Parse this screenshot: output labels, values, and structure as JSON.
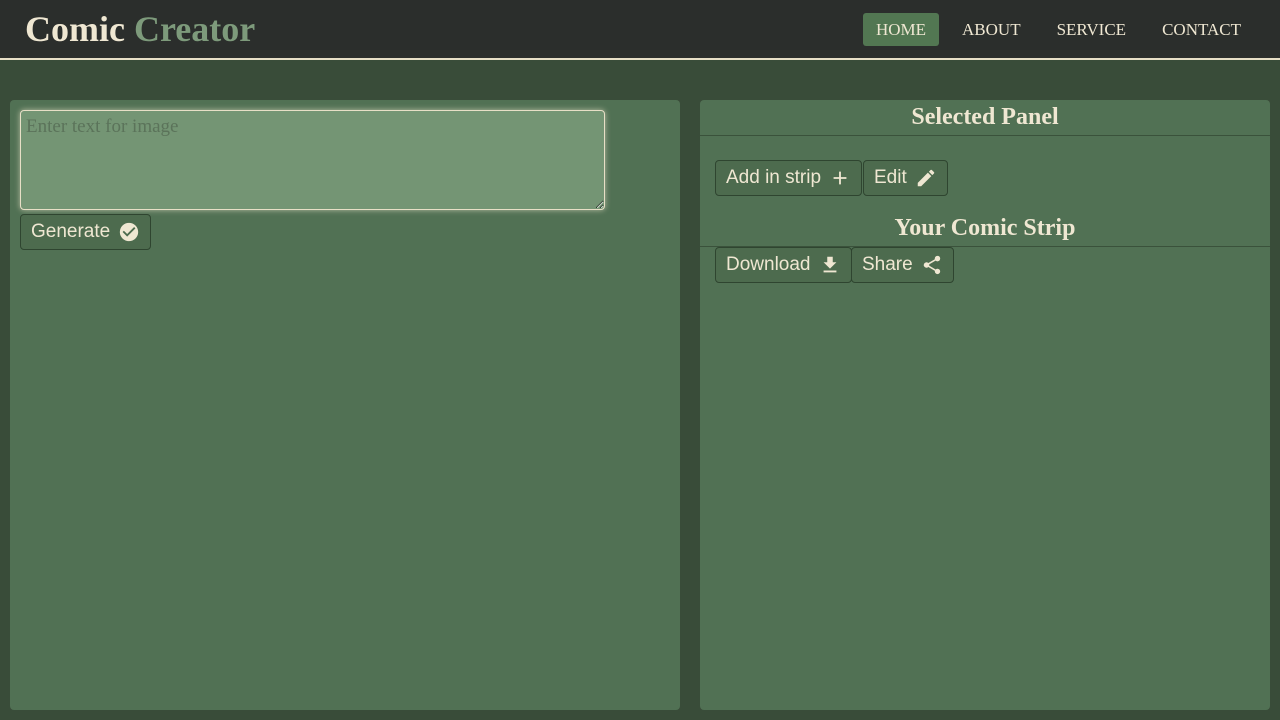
{
  "brand": {
    "word1": "Comic",
    "word2": "Creator"
  },
  "nav": {
    "items": [
      {
        "label": "HOME",
        "active": true
      },
      {
        "label": "ABOUT",
        "active": false
      },
      {
        "label": "SERVICE",
        "active": false
      },
      {
        "label": "CONTACT",
        "active": false
      }
    ]
  },
  "editor": {
    "placeholder": "Enter text for image",
    "value": "",
    "generate_label": "Generate",
    "generate_icon": "check-circle-icon"
  },
  "selected_panel": {
    "title": "Selected Panel",
    "add_label": "Add in strip",
    "add_icon": "plus-icon",
    "edit_label": "Edit",
    "edit_icon": "pencil-icon"
  },
  "comic_strip": {
    "title": "Your Comic Strip",
    "download_label": "Download",
    "download_icon": "download-icon",
    "share_label": "Share",
    "share_icon": "share-icon"
  },
  "colors": {
    "background": "#394c39",
    "navbar": "#2b2e2c",
    "panel": "#517154",
    "accent": "#7d9a7b",
    "active_nav": "#527752",
    "text": "#efe7d2"
  }
}
